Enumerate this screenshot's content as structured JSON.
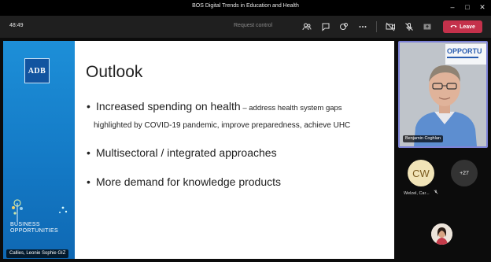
{
  "window": {
    "title": "BOS Digital Trends in Education and Health",
    "controls": [
      "–",
      "□",
      "✕"
    ]
  },
  "toolbar": {
    "timer": "48:49",
    "request_control": "Request control",
    "leave_label": "Leave",
    "icons": [
      "people-icon",
      "chat-icon",
      "reactions-icon",
      "more-icon",
      "camera-off-icon",
      "mic-off-icon",
      "share-icon"
    ]
  },
  "slide": {
    "logo_text": "ADB",
    "branding": "BUSINESS OPPORTUNITIES",
    "title": "Outlook",
    "bullet1_main": "Increased spending on health",
    "bullet1_dash": " – address health system gaps",
    "bullet1_cont": "highlighted by COVID-19 pandemic, improve preparedness, achieve UHC",
    "bullet2": "Multisectoral / integrated approaches",
    "bullet3": "More demand for knowledge products",
    "presenter_tag": "Callies, Leonie Sophie GIZ"
  },
  "participants": {
    "speaker_name": "Benjamin Coghlan",
    "background_text": "OPPORTU",
    "cw_initials": "CW",
    "cw_name": "Welzel, Car...",
    "more_count": "+27"
  },
  "colors": {
    "slide_band": "#1378c4",
    "leave_button": "#c4314b",
    "active_speaker_border": "#7c82d6"
  }
}
